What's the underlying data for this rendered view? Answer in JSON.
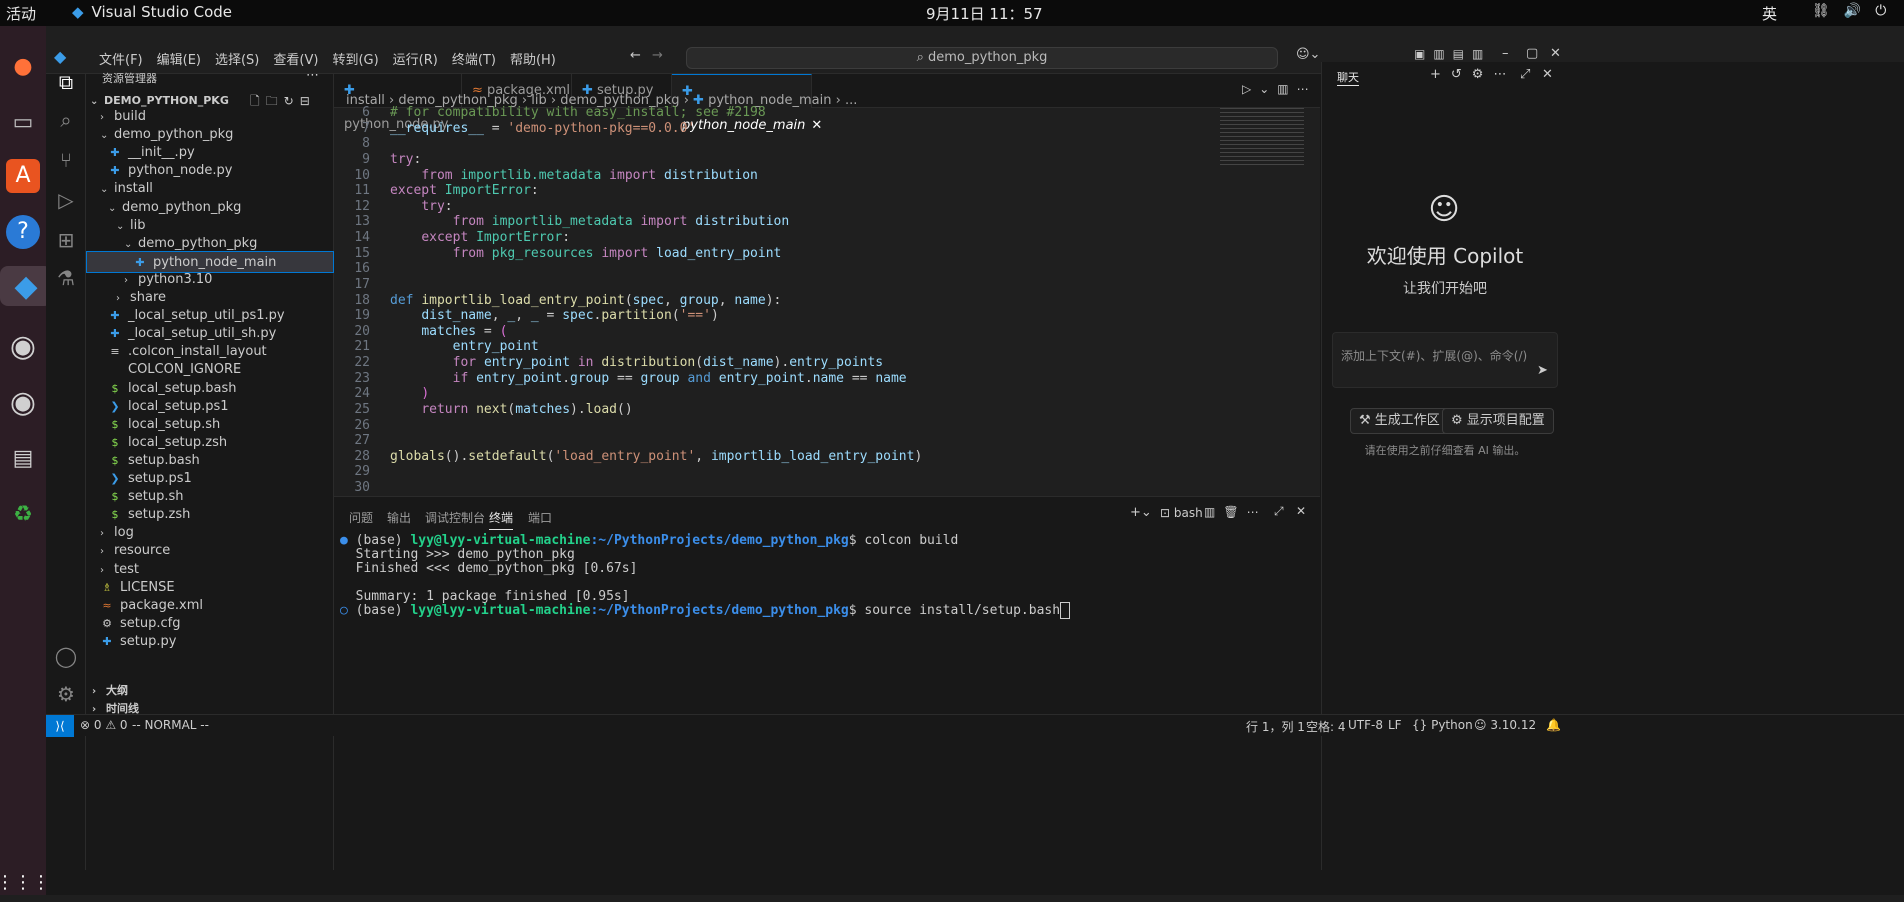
{
  "topbar": {
    "activities": "活动",
    "app_name": "Visual Studio Code",
    "clock": "9月11日  11：57",
    "ime": "英"
  },
  "menu": [
    "文件(F)",
    "编辑(E)",
    "选择(S)",
    "查看(V)",
    "转到(G)",
    "运行(R)",
    "终端(T)",
    "帮助(H)"
  ],
  "search": {
    "text": "demo_python_pkg"
  },
  "sidebar": {
    "title": "资源管理器",
    "root": "DEMO_PYTHON_PKG",
    "items": [
      {
        "label": "build",
        "indent": 0,
        "type": "folder",
        "open": false
      },
      {
        "label": "demo_python_pkg",
        "indent": 0,
        "type": "folder",
        "open": true
      },
      {
        "label": "__init__.py",
        "indent": 1,
        "type": "py"
      },
      {
        "label": "python_node.py",
        "indent": 1,
        "type": "py"
      },
      {
        "label": "install",
        "indent": 0,
        "type": "folder",
        "open": true
      },
      {
        "label": "demo_python_pkg",
        "indent": 1,
        "type": "folder",
        "open": true
      },
      {
        "label": "lib",
        "indent": 2,
        "type": "folder",
        "open": true
      },
      {
        "label": "demo_python_pkg",
        "indent": 3,
        "type": "folder",
        "open": true
      },
      {
        "label": "python_node_main",
        "indent": 4,
        "type": "py",
        "selected": true
      },
      {
        "label": "python3.10",
        "indent": 3,
        "type": "folder",
        "open": false
      },
      {
        "label": "share",
        "indent": 2,
        "type": "folder",
        "open": false
      },
      {
        "label": "_local_setup_util_ps1.py",
        "indent": 1,
        "type": "py"
      },
      {
        "label": "_local_setup_util_sh.py",
        "indent": 1,
        "type": "py"
      },
      {
        "label": ".colcon_install_layout",
        "indent": 1,
        "type": "txt"
      },
      {
        "label": "COLCON_IGNORE",
        "indent": 1,
        "type": "none"
      },
      {
        "label": "local_setup.bash",
        "indent": 1,
        "type": "sh"
      },
      {
        "label": "local_setup.ps1",
        "indent": 1,
        "type": "ps"
      },
      {
        "label": "local_setup.sh",
        "indent": 1,
        "type": "sh"
      },
      {
        "label": "local_setup.zsh",
        "indent": 1,
        "type": "sh"
      },
      {
        "label": "setup.bash",
        "indent": 1,
        "type": "sh"
      },
      {
        "label": "setup.ps1",
        "indent": 1,
        "type": "ps"
      },
      {
        "label": "setup.sh",
        "indent": 1,
        "type": "sh"
      },
      {
        "label": "setup.zsh",
        "indent": 1,
        "type": "sh"
      },
      {
        "label": "log",
        "indent": 0,
        "type": "folder",
        "open": false
      },
      {
        "label": "resource",
        "indent": 0,
        "type": "folder",
        "open": false
      },
      {
        "label": "test",
        "indent": 0,
        "type": "folder",
        "open": false
      },
      {
        "label": "LICENSE",
        "indent": 0,
        "type": "lic"
      },
      {
        "label": "package.xml",
        "indent": 0,
        "type": "xml"
      },
      {
        "label": "setup.cfg",
        "indent": 0,
        "type": "cfg"
      },
      {
        "label": "setup.py",
        "indent": 0,
        "type": "py"
      }
    ],
    "outline": "大纲",
    "timeline": "时间线"
  },
  "tabs": [
    {
      "label": "python_node.py",
      "active": false
    },
    {
      "label": "package.xml",
      "active": false
    },
    {
      "label": "setup.py",
      "active": false
    },
    {
      "label": "python_node_main",
      "active": true
    }
  ],
  "breadcrumb": [
    "install",
    "demo_python_pkg",
    "lib",
    "demo_python_pkg",
    "python_node_main",
    "..."
  ],
  "code": [
    {
      "n": "6",
      "html": "<span class='c'># for compatibility with easy_install; see #2198</span>"
    },
    {
      "n": "7",
      "html": "<span class='v'>__requires__</span> = <span class='s'>'demo-python-pkg==0.0.0'</span>"
    },
    {
      "n": "8",
      "html": ""
    },
    {
      "n": "9",
      "html": "<span class='k'>try</span>:"
    },
    {
      "n": "10",
      "html": "    <span class='k'>from</span> <span class='t'>importlib.metadata</span> <span class='k'>import</span> <span class='v'>distribution</span>"
    },
    {
      "n": "11",
      "html": "<span class='k'>except</span> <span class='t'>ImportError</span>:"
    },
    {
      "n": "12",
      "html": "    <span class='k'>try</span>:"
    },
    {
      "n": "13",
      "html": "        <span class='k'>from</span> <span class='t'>importlib_metadata</span> <span class='k'>import</span> <span class='v'>distribution</span>"
    },
    {
      "n": "14",
      "html": "    <span class='k'>except</span> <span class='t'>ImportError</span>:"
    },
    {
      "n": "15",
      "html": "        <span class='k'>from</span> <span class='t'>pkg_resources</span> <span class='k'>import</span> <span class='v'>load_entry_point</span>"
    },
    {
      "n": "16",
      "html": ""
    },
    {
      "n": "17",
      "html": ""
    },
    {
      "n": "18",
      "html": "<span class='kw2'>def</span> <span class='f'>importlib_load_entry_point</span>(<span class='v'>spec</span>, <span class='v'>group</span>, <span class='v'>name</span>):"
    },
    {
      "n": "19",
      "html": "    <span class='v'>dist_name</span>, <span class='v'>_</span>, <span class='v'>_</span> = <span class='v'>spec</span>.<span class='f'>partition</span>(<span class='s'>'=='</span>)"
    },
    {
      "n": "20",
      "html": "    <span class='v'>matches</span> = <span class='p2'>(</span>"
    },
    {
      "n": "21",
      "html": "        <span class='v'>entry_point</span>"
    },
    {
      "n": "22",
      "html": "        <span class='k'>for</span> <span class='v'>entry_point</span> <span class='k'>in</span> <span class='f'>distribution</span>(<span class='v'>dist_name</span>).<span class='v'>entry_points</span>"
    },
    {
      "n": "23",
      "html": "        <span class='k'>if</span> <span class='v'>entry_point</span>.<span class='v'>group</span> == <span class='v'>group</span> <span class='kw2'>and</span> <span class='v'>entry_point</span>.<span class='v'>name</span> == <span class='v'>name</span>"
    },
    {
      "n": "24",
      "html": "    <span class='p2'>)</span>"
    },
    {
      "n": "25",
      "html": "    <span class='k'>return</span> <span class='f'>next</span>(<span class='v'>matches</span>).<span class='f'>load</span>()"
    },
    {
      "n": "26",
      "html": ""
    },
    {
      "n": "27",
      "html": ""
    },
    {
      "n": "28",
      "html": "<span class='f'>globals</span>().<span class='f'>setdefault</span>(<span class='s'>'load_entry_point'</span>, <span class='v'>importlib_load_entry_point</span>)"
    },
    {
      "n": "29",
      "html": ""
    },
    {
      "n": "30",
      "html": ""
    }
  ],
  "panel": {
    "tabs": [
      "问题",
      "输出",
      "调试控制台",
      "终端",
      "端口"
    ],
    "shell": "bash",
    "terminal": [
      {
        "prompt_base": "(base) ",
        "user": "lyy@lyy-virtual-machine",
        "path": ":~/PythonProjects/demo_python_pkg",
        "cmd": "$ colcon build"
      },
      {
        "text": "Starting >>> demo_python_pkg"
      },
      {
        "text": "Finished <<< demo_python_pkg [0.67s]"
      },
      {
        "text": ""
      },
      {
        "text": "Summary: 1 package finished [0.95s]"
      },
      {
        "prompt_base": "(base) ",
        "user": "lyy@lyy-virtual-machine",
        "path": ":~/PythonProjects/demo_python_pkg",
        "cmd": "$ source install/setup.bash"
      }
    ]
  },
  "chat": {
    "title": "聊天",
    "welcome": "欢迎使用 Copilot",
    "subtitle": "让我们开始吧",
    "placeholder": "添加上下文(#)、扩展(@)、命令(/)",
    "btn_workspace": "生成工作区",
    "btn_config": "显示项目配置",
    "disclaimer": "请在使用之前仔细查看 AI 输出。"
  },
  "status": {
    "errors": "0",
    "warnings": "0",
    "mode": "-- NORMAL --",
    "position": "行 1，列 1",
    "spaces": "空格: 4",
    "encoding": "UTF-8",
    "eol": "LF",
    "language": "Python",
    "version": "3.10.12"
  }
}
